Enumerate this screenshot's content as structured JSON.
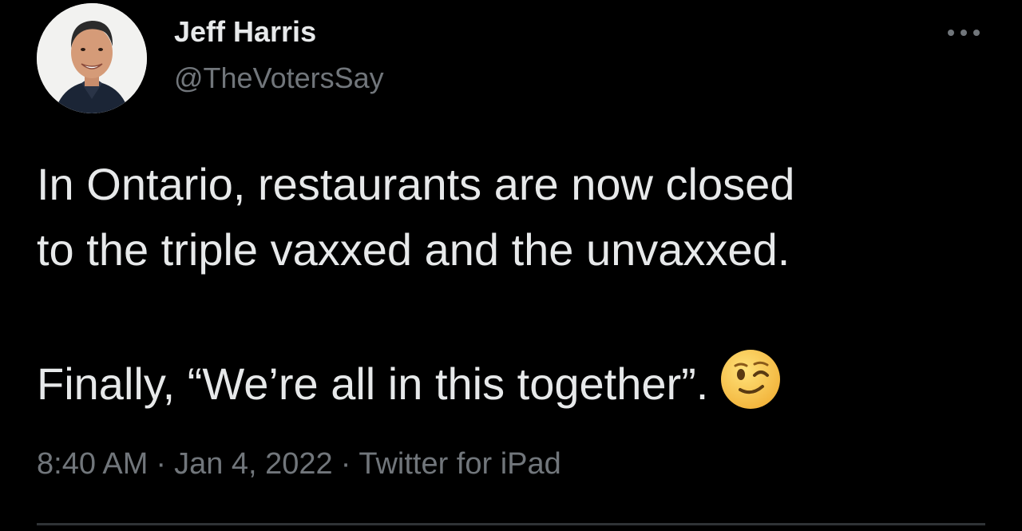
{
  "author": {
    "name": "Jeff Harris",
    "handle": "@TheVotersSay",
    "avatar_icon": "person-portrait-icon"
  },
  "actions": {
    "more_icon": "more-horizontal-icon"
  },
  "tweet": {
    "line1": "In Ontario, restaurants are now closed",
    "line2": "to the triple vaxxed and the unvaxxed.",
    "line3": "Finally, “We’re all in this together”.",
    "emoji": "winking-face-icon"
  },
  "meta": {
    "time": "8:40 AM",
    "separator": "·",
    "date": "Jan 4, 2022",
    "source": "Twitter for iPad"
  },
  "colors": {
    "background": "#000000",
    "primary_text": "#e7e9ea",
    "secondary_text": "#71767b",
    "divider": "#2f3336"
  }
}
